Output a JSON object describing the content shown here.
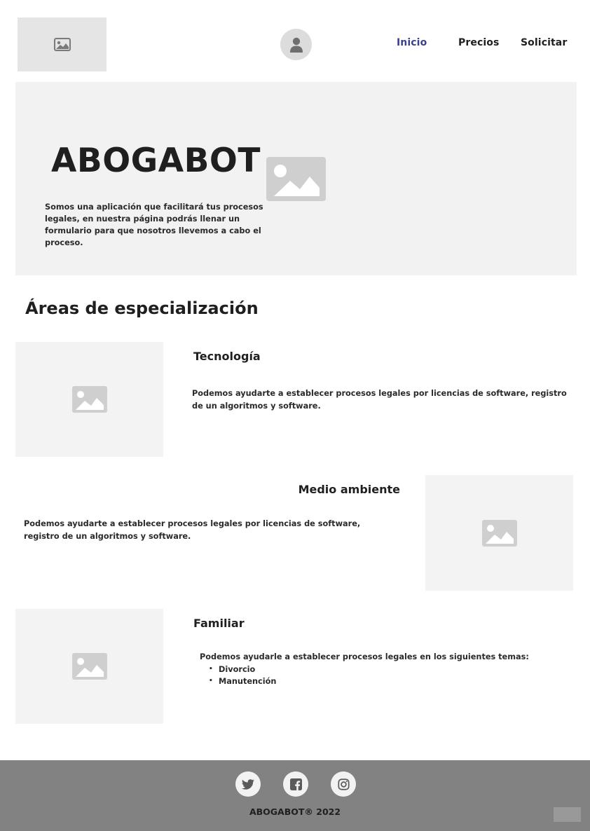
{
  "header": {
    "logo_icon": "image-placeholder-icon",
    "avatar_icon": "user-icon",
    "nav": [
      {
        "label": "Inicio",
        "active": true
      },
      {
        "label": "Precios",
        "active": false
      },
      {
        "label": "Solicitar",
        "active": false
      }
    ],
    "accent_color": "#3a3f8f"
  },
  "hero": {
    "title": "ABOGABOT",
    "description": "Somos una aplicación que facilitará tus procesos legales, en nuestra página podrás llenar un formulario para que nosotros llevemos a cabo el proceso.",
    "image_icon": "image-placeholder-icon"
  },
  "areas": {
    "heading": "Áreas de especialización",
    "items": [
      {
        "title": "Tecnología",
        "text": "Podemos ayudarte a establecer procesos legales por licencias de software, registro de un algoritmos y software."
      },
      {
        "title": "Medio ambiente",
        "text": "Podemos ayudarte a establecer procesos legales por licencias de software, registro de un algoritmos y software."
      },
      {
        "title": "Familiar",
        "text": "Podemos ayudarle a establecer procesos legales en los siguientes temas:",
        "topics": [
          "Divorcio",
          "Manutención"
        ]
      }
    ]
  },
  "footer": {
    "social": [
      "twitter-icon",
      "facebook-icon",
      "instagram-icon"
    ],
    "copyright": "ABOGABOT® 2022"
  }
}
